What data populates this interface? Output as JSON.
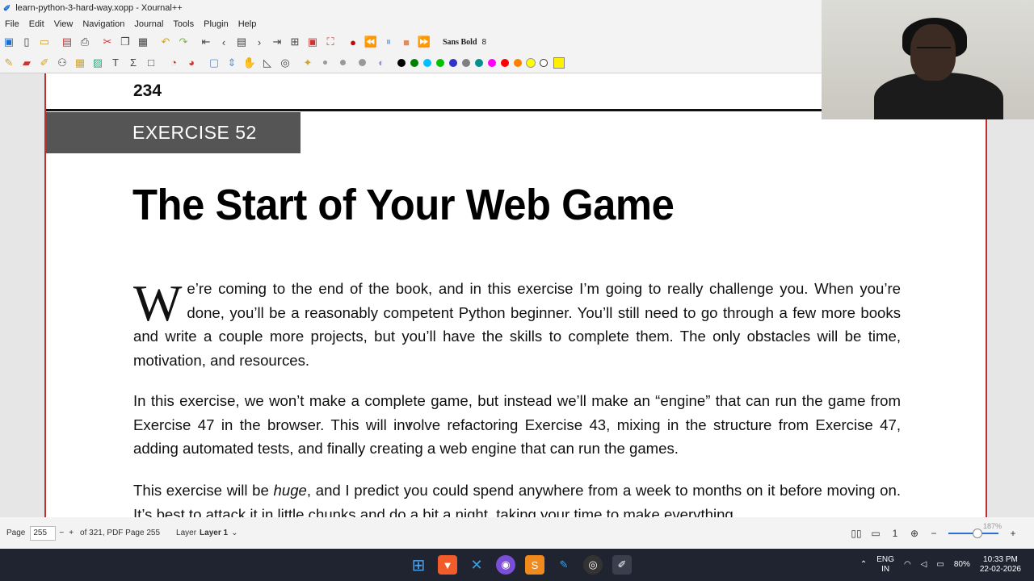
{
  "window": {
    "title": "learn-python-3-hard-way.xopp - Xournal++",
    "app_icon": "xournal-icon"
  },
  "menu": [
    "File",
    "Edit",
    "View",
    "Navigation",
    "Journal",
    "Tools",
    "Plugin",
    "Help"
  ],
  "toolbar": {
    "font_name": "Sans Bold",
    "font_size": "8"
  },
  "colors": {
    "palette": [
      "#000000",
      "#008000",
      "#00c0ff",
      "#00c000",
      "#3333cc",
      "#808080",
      "#009090",
      "#ff00ff",
      "#ff0000",
      "#ff8000",
      "#ffff00",
      "#ffffff"
    ],
    "highlighter": "#ffef00",
    "page_border": "#c03030"
  },
  "document": {
    "page_number": "234",
    "exercise_label": "EXERCISE 52",
    "title": "The Start of Your Web Game",
    "dropcap": "W",
    "para1": "e’re coming to the end of the book, and in this exercise I’m going to really challenge you. When you’re done, you’ll be a reasonably competent Python beginner. You’ll still need to go through a few more books and write a couple more projects, but you’ll have the skills to complete them. The only obstacles will be time, motivation, and resources.",
    "para2": "In this exercise, we won’t make a complete game, but instead we’ll make an “engine” that can run the game from Exercise 47 in the browser. This will involve refactoring Exercise 43, mixing in the structure from Exercise 47, adding automated tests, and finally creating a web engine that can run the games.",
    "para3_before": "This exercise will be ",
    "para3_em": "huge",
    "para3_after": ", and I predict you could spend anywhere from a week to months on it before moving on. It’s best to attack it in little chunks and do a bit a night, taking your time to make everything"
  },
  "status": {
    "page_label": "Page",
    "page_value": "255",
    "page_total": "of 321, PDF Page 255",
    "layer_label": "Layer",
    "layer_value": "Layer 1",
    "zoom": "187%",
    "zoom_fraction": 0.58
  },
  "taskbar": {
    "lang_top": "ENG",
    "lang_bottom": "IN",
    "battery": "80%",
    "time": "10:33 PM",
    "date": "22-02-2026"
  }
}
